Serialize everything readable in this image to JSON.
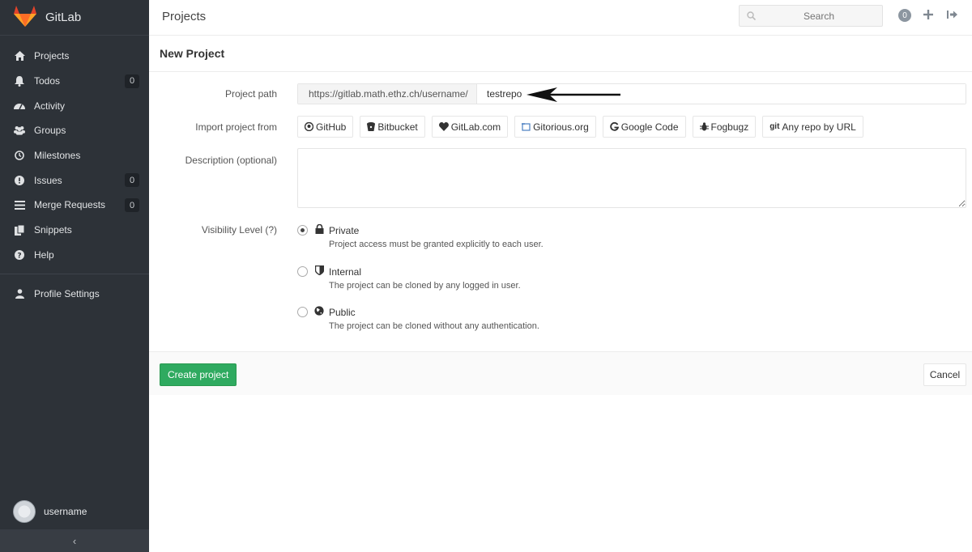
{
  "brand": {
    "name": "GitLab",
    "logo_icon": "gitlab-fox-logo"
  },
  "sidebar": {
    "items": [
      {
        "label": "Projects",
        "icon": "home-icon"
      },
      {
        "label": "Todos",
        "icon": "bell-icon",
        "badge": "0"
      },
      {
        "label": "Activity",
        "icon": "dashboard-icon"
      },
      {
        "label": "Groups",
        "icon": "users-icon"
      },
      {
        "label": "Milestones",
        "icon": "clock-icon"
      },
      {
        "label": "Issues",
        "icon": "exclamation-circle-icon",
        "badge": "0"
      },
      {
        "label": "Merge Requests",
        "icon": "list-icon",
        "badge": "0"
      },
      {
        "label": "Snippets",
        "icon": "clipboard-icon"
      },
      {
        "label": "Help",
        "icon": "question-circle-icon"
      }
    ],
    "profile": {
      "label": "Profile Settings",
      "icon": "user-icon"
    },
    "user": {
      "name": "username"
    },
    "collapse": "‹"
  },
  "header": {
    "title": "Projects",
    "search_placeholder": "Search",
    "todo_count": "0"
  },
  "form": {
    "heading": "New Project",
    "project_path": {
      "label": "Project path",
      "prefix": "https://gitlab.math.ethz.ch/username/",
      "value": "testrepo"
    },
    "import": {
      "label": "Import project from",
      "sources": [
        {
          "label": "GitHub",
          "icon": "github-icon"
        },
        {
          "label": "Bitbucket",
          "icon": "bitbucket-icon"
        },
        {
          "label": "GitLab.com",
          "icon": "heart-icon"
        },
        {
          "label": "Gitorious.org",
          "icon": "gitorious-icon"
        },
        {
          "label": "Google Code",
          "icon": "google-icon"
        },
        {
          "label": "Fogbugz",
          "icon": "bug-icon"
        },
        {
          "label": "Any repo by URL",
          "icon": "git-icon",
          "prefix": "git"
        }
      ]
    },
    "description": {
      "label": "Description (optional)",
      "value": ""
    },
    "visibility": {
      "label": "Visibility Level (?)",
      "selected": "Private",
      "options": [
        {
          "title": "Private",
          "description": "Project access must be granted explicitly to each user.",
          "icon": "lock-icon"
        },
        {
          "title": "Internal",
          "description": "The project can be cloned by any logged in user.",
          "icon": "shield-icon"
        },
        {
          "title": "Public",
          "description": "The project can be cloned without any authentication.",
          "icon": "globe-icon"
        }
      ]
    },
    "create_label": "Create project",
    "cancel_label": "Cancel"
  },
  "colors": {
    "sidebar_bg": "#2d3238",
    "create_button": "#2faa60",
    "logo_orange": "#e2432a"
  }
}
